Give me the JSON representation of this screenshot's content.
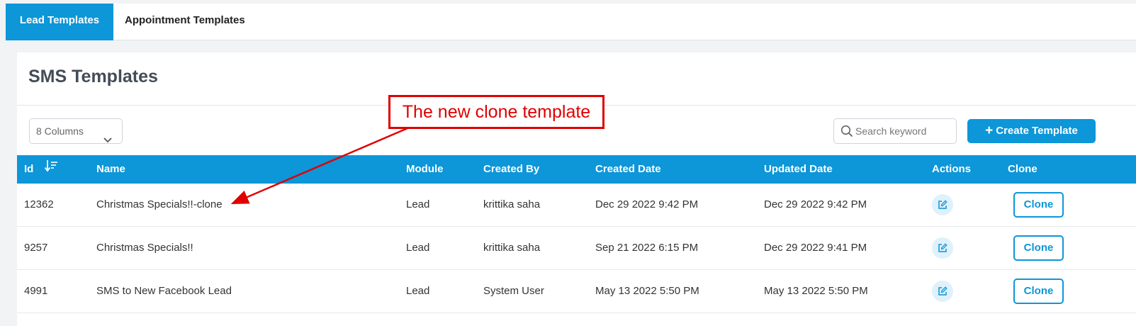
{
  "tabs": [
    {
      "label": "Lead Templates",
      "active": true
    },
    {
      "label": "Appointment Templates",
      "active": false
    }
  ],
  "page_title": "SMS Templates",
  "columns_select": {
    "value": "8 Columns"
  },
  "search": {
    "placeholder": "Search keyword",
    "value": ""
  },
  "create_button": {
    "label": "Create Template"
  },
  "table": {
    "headers": {
      "id": "Id",
      "name": "Name",
      "module": "Module",
      "created_by": "Created By",
      "created_date": "Created Date",
      "updated_date": "Updated Date",
      "actions": "Actions",
      "clone": "Clone"
    },
    "rows": [
      {
        "id": "12362",
        "name": "Christmas Specials!!-clone",
        "module": "Lead",
        "created_by": "krittika saha",
        "created_date": "Dec 29 2022 9:42 PM",
        "updated_date": "Dec 29 2022 9:42 PM",
        "clone_label": "Clone"
      },
      {
        "id": "9257",
        "name": "Christmas Specials!!",
        "module": "Lead",
        "created_by": "krittika saha",
        "created_date": "Sep 21 2022 6:15 PM",
        "updated_date": "Dec 29 2022 9:41 PM",
        "clone_label": "Clone"
      },
      {
        "id": "4991",
        "name": "SMS to New Facebook Lead",
        "module": "Lead",
        "created_by": "System User",
        "created_date": "May 13 2022 5:50 PM",
        "updated_date": "May 13 2022 5:50 PM",
        "clone_label": "Clone"
      }
    ]
  },
  "annotation": {
    "text": "The new clone template"
  },
  "colors": {
    "accent": "#0d96d8",
    "annotation": "#e00000"
  },
  "icons": [
    "chevron-down-icon",
    "search-icon",
    "plus-icon",
    "sort-desc-icon",
    "edit-icon"
  ]
}
